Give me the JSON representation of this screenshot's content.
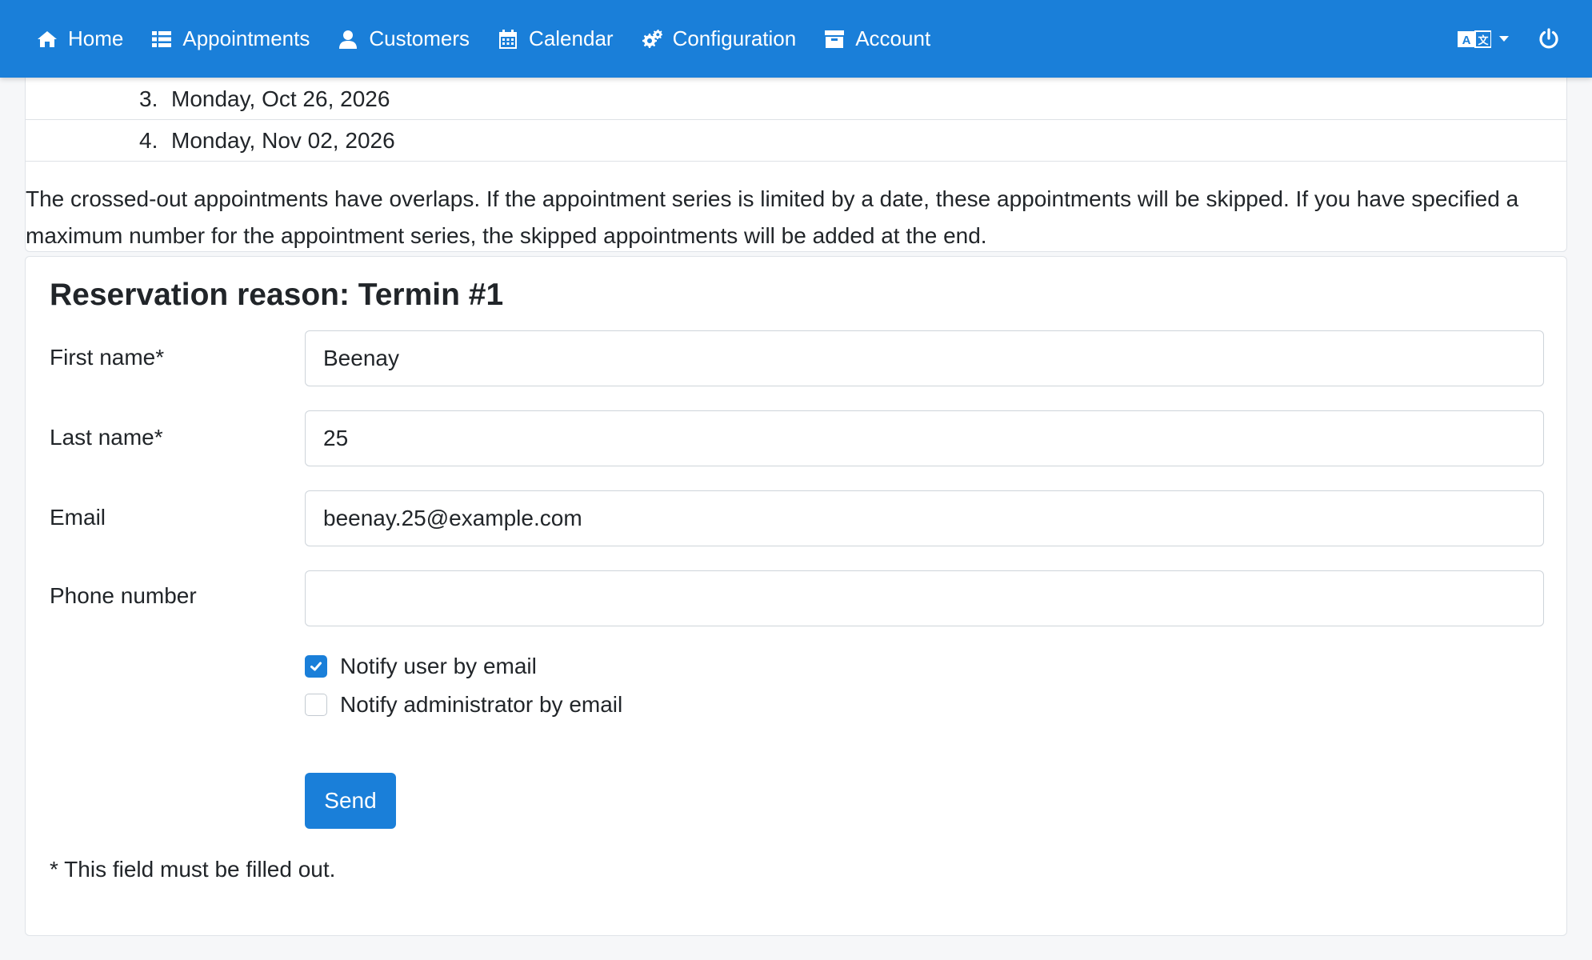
{
  "nav": {
    "items": [
      {
        "label": "Home",
        "icon": "home-icon"
      },
      {
        "label": "Appointments",
        "icon": "list-icon"
      },
      {
        "label": "Customers",
        "icon": "user-icon"
      },
      {
        "label": "Calendar",
        "icon": "calendar-icon"
      },
      {
        "label": "Configuration",
        "icon": "gears-icon"
      },
      {
        "label": "Account",
        "icon": "archive-icon"
      }
    ],
    "language_icon": "language-icon",
    "power_icon": "power-icon",
    "accent_color": "#1a7fd9"
  },
  "appointments": [
    {
      "number": "3.",
      "date": "Monday, Oct 26, 2026"
    },
    {
      "number": "4.",
      "date": "Monday, Nov 02, 2026"
    }
  ],
  "notice": "The crossed-out appointments have overlaps. If the appointment series is limited by a date, these appointments will be skipped. If you have specified a maximum number for the appointment series, the skipped appointments will be added at the end.",
  "form": {
    "title": "Reservation reason: Termin #1",
    "first_name": {
      "label": "First name*",
      "value": "Beenay"
    },
    "last_name": {
      "label": "Last name*",
      "value": "25"
    },
    "email": {
      "label": "Email",
      "value": "beenay.25@example.com"
    },
    "phone": {
      "label": "Phone number",
      "value": ""
    },
    "notify_user": {
      "label": "Notify user by email",
      "checked": true
    },
    "notify_admin": {
      "label": "Notify administrator by email",
      "checked": false
    },
    "send_label": "Send",
    "required_note": "* This field must be filled out."
  }
}
